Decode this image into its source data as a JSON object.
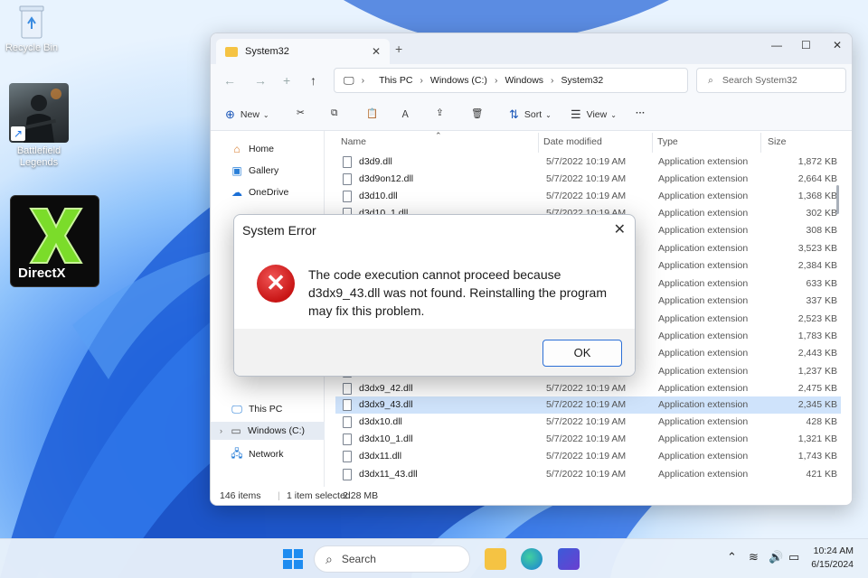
{
  "desktop": {
    "icons": [
      {
        "label": "Recycle Bin"
      },
      {
        "label": "Battlefield Legends"
      },
      {
        "label": "DirectX"
      }
    ]
  },
  "explorer": {
    "tab_title": "System32",
    "breadcrumbs": [
      "This PC",
      "Windows (C:)",
      "Windows",
      "System32"
    ],
    "search_placeholder": "Search System32",
    "toolbar": {
      "new": "New",
      "sort": "Sort",
      "view": "View"
    },
    "nav": {
      "home": "Home",
      "gallery": "Gallery",
      "onedrive": "OneDrive",
      "this_pc": "This PC",
      "windows_c": "Windows (C:)",
      "network": "Network"
    },
    "columns": {
      "name": "Name",
      "date": "Date modified",
      "type": "Type",
      "size": "Size"
    },
    "files": [
      {
        "name": "d3d9.dll",
        "date": "5/7/2022 10:19 AM",
        "type": "Application extension",
        "size": "1,872 KB"
      },
      {
        "name": "d3d9on12.dll",
        "date": "5/7/2022 10:19 AM",
        "type": "Application extension",
        "size": "2,664 KB"
      },
      {
        "name": "d3d10.dll",
        "date": "5/7/2022 10:19 AM",
        "type": "Application extension",
        "size": "1,368 KB"
      },
      {
        "name": "d3d10_1.dll",
        "date": "5/7/2022 10:19 AM",
        "type": "Application extension",
        "size": "302 KB"
      },
      {
        "name": "",
        "date": "5/7/2022 10:19 AM",
        "type": "Application extension",
        "size": "308 KB"
      },
      {
        "name": "",
        "date": "5/7/2022 10:19 AM",
        "type": "Application extension",
        "size": "3,523 KB"
      },
      {
        "name": "",
        "date": "5/7/2022 10:19 AM",
        "type": "Application extension",
        "size": "2,384 KB"
      },
      {
        "name": "",
        "date": "5/7/2022 10:19 AM",
        "type": "Application extension",
        "size": "633 KB"
      },
      {
        "name": "",
        "date": "5/7/2022 10:19 AM",
        "type": "Application extension",
        "size": "337 KB"
      },
      {
        "name": "",
        "date": "5/7/2022 10:19 AM",
        "type": "Application extension",
        "size": "2,523 KB"
      },
      {
        "name": "",
        "date": "5/7/2022 10:19 AM",
        "type": "Application extension",
        "size": "1,783 KB"
      },
      {
        "name": "",
        "date": "5/7/2022 10:19 AM",
        "type": "Application extension",
        "size": "2,443 KB"
      },
      {
        "name": "",
        "date": "5/7/2022 10:19 AM",
        "type": "Application extension",
        "size": "1,237 KB"
      },
      {
        "name": "d3dx9_42.dll",
        "date": "5/7/2022 10:19 AM",
        "type": "Application extension",
        "size": "2,475 KB"
      },
      {
        "name": "d3dx9_43.dll",
        "date": "5/7/2022 10:19 AM",
        "type": "Application extension",
        "size": "2,345 KB"
      },
      {
        "name": "d3dx10.dll",
        "date": "5/7/2022 10:19 AM",
        "type": "Application extension",
        "size": "428 KB"
      },
      {
        "name": "d3dx10_1.dll",
        "date": "5/7/2022 10:19 AM",
        "type": "Application extension",
        "size": "1,321 KB"
      },
      {
        "name": "d3dx11.dll",
        "date": "5/7/2022 10:19 AM",
        "type": "Application extension",
        "size": "1,743 KB"
      },
      {
        "name": "d3dx11_43.dll",
        "date": "5/7/2022 10:19 AM",
        "type": "Application extension",
        "size": "421 KB"
      }
    ],
    "status": {
      "items": "146 items",
      "selected": "1 item selected",
      "size": "2.28 MB"
    }
  },
  "dialog": {
    "title": "System Error",
    "message": "The code execution cannot proceed because d3dx9_43.dll was not found. Reinstalling the program may fix this problem.",
    "ok": "OK"
  },
  "taskbar": {
    "search": "Search",
    "time": "10:24 AM",
    "date": "6/15/2024"
  }
}
